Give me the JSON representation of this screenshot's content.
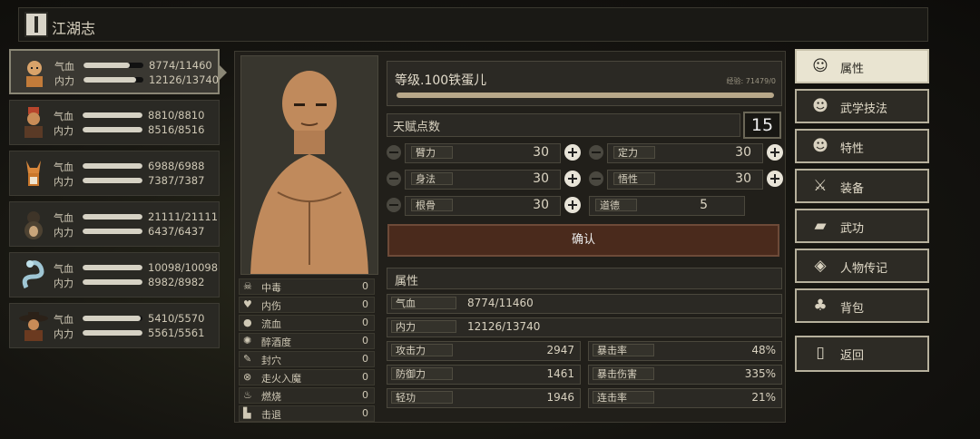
{
  "header": {
    "title": "江湖志",
    "icon": "book-icon"
  },
  "party": [
    {
      "avatar": "monk-avatar",
      "hp_label": "气血",
      "hp": "8774/11460",
      "hp_frac": 0.77,
      "mp_label": "内力",
      "mp": "12126/13740",
      "mp_frac": 0.88,
      "selected": true
    },
    {
      "avatar": "warrior-avatar",
      "hp_label": "气血",
      "hp": "8810/8810",
      "hp_frac": 1,
      "mp_label": "内力",
      "mp": "8516/8516",
      "mp_frac": 1
    },
    {
      "avatar": "fox-avatar",
      "hp_label": "气血",
      "hp": "6988/6988",
      "hp_frac": 1,
      "mp_label": "内力",
      "mp": "7387/7387",
      "mp_frac": 1
    },
    {
      "avatar": "bear-avatar",
      "hp_label": "气血",
      "hp": "21111/21111",
      "hp_frac": 1,
      "mp_label": "内力",
      "mp": "6437/6437",
      "mp_frac": 1
    },
    {
      "avatar": "snake-avatar",
      "hp_label": "气血",
      "hp": "10098/10098",
      "hp_frac": 1,
      "mp_label": "内力",
      "mp": "8982/8982",
      "mp_frac": 1
    },
    {
      "avatar": "hat-avatar",
      "hp_label": "气血",
      "hp": "5410/5570",
      "hp_frac": 0.97,
      "mp_label": "内力",
      "mp": "5561/5561",
      "mp_frac": 1
    }
  ],
  "character": {
    "level_title": "等级.100铁蛋儿",
    "exp": "经验: 71479/0",
    "exp_frac": 1,
    "talent_label": "天赋点数",
    "talent_points": "15",
    "stats": [
      {
        "name": "臂力",
        "value": "30"
      },
      {
        "name": "定力",
        "value": "30"
      },
      {
        "name": "身法",
        "value": "30"
      },
      {
        "name": "悟性",
        "value": "30"
      },
      {
        "name": "根骨",
        "value": "30"
      },
      {
        "name": "道德",
        "value": "5"
      }
    ],
    "confirm_label": "确认"
  },
  "status_effects": [
    {
      "icon": "skull-icon",
      "name": "中毒",
      "value": "0"
    },
    {
      "icon": "broken-heart-icon",
      "name": "内伤",
      "value": "0"
    },
    {
      "icon": "blood-drop-icon",
      "name": "流血",
      "value": "0"
    },
    {
      "icon": "drunk-icon",
      "name": "醉酒度",
      "value": "0"
    },
    {
      "icon": "seal-icon",
      "name": "封穴",
      "value": "0"
    },
    {
      "icon": "madness-icon",
      "name": "走火入魔",
      "value": "0"
    },
    {
      "icon": "fire-icon",
      "name": "燃烧",
      "value": "0"
    },
    {
      "icon": "knockback-icon",
      "name": "击退",
      "value": "0"
    }
  ],
  "attributes": {
    "header": "属性",
    "hp_label": "气血",
    "hp_value": "8774/11460",
    "mp_label": "内力",
    "mp_value": "12126/13740",
    "grid": [
      {
        "name": "攻击力",
        "value": "2947"
      },
      {
        "name": "暴击率",
        "value": "48%"
      },
      {
        "name": "防御力",
        "value": "1461"
      },
      {
        "name": "暴击伤害",
        "value": "335%"
      },
      {
        "name": "轻功",
        "value": "1946"
      },
      {
        "name": "连击率",
        "value": "21%"
      }
    ]
  },
  "menu": [
    {
      "icon": "person-icon",
      "label": "属性",
      "active": true
    },
    {
      "icon": "martial-person-icon",
      "label": "武学技法"
    },
    {
      "icon": "trait-person-icon",
      "label": "特性"
    },
    {
      "icon": "sword-icon",
      "label": "装备"
    },
    {
      "icon": "scroll-icon",
      "label": "武功"
    },
    {
      "icon": "biography-icon",
      "label": "人物传记"
    },
    {
      "icon": "bag-icon",
      "label": "背包"
    },
    {
      "icon": "door-icon",
      "label": "返回"
    }
  ]
}
